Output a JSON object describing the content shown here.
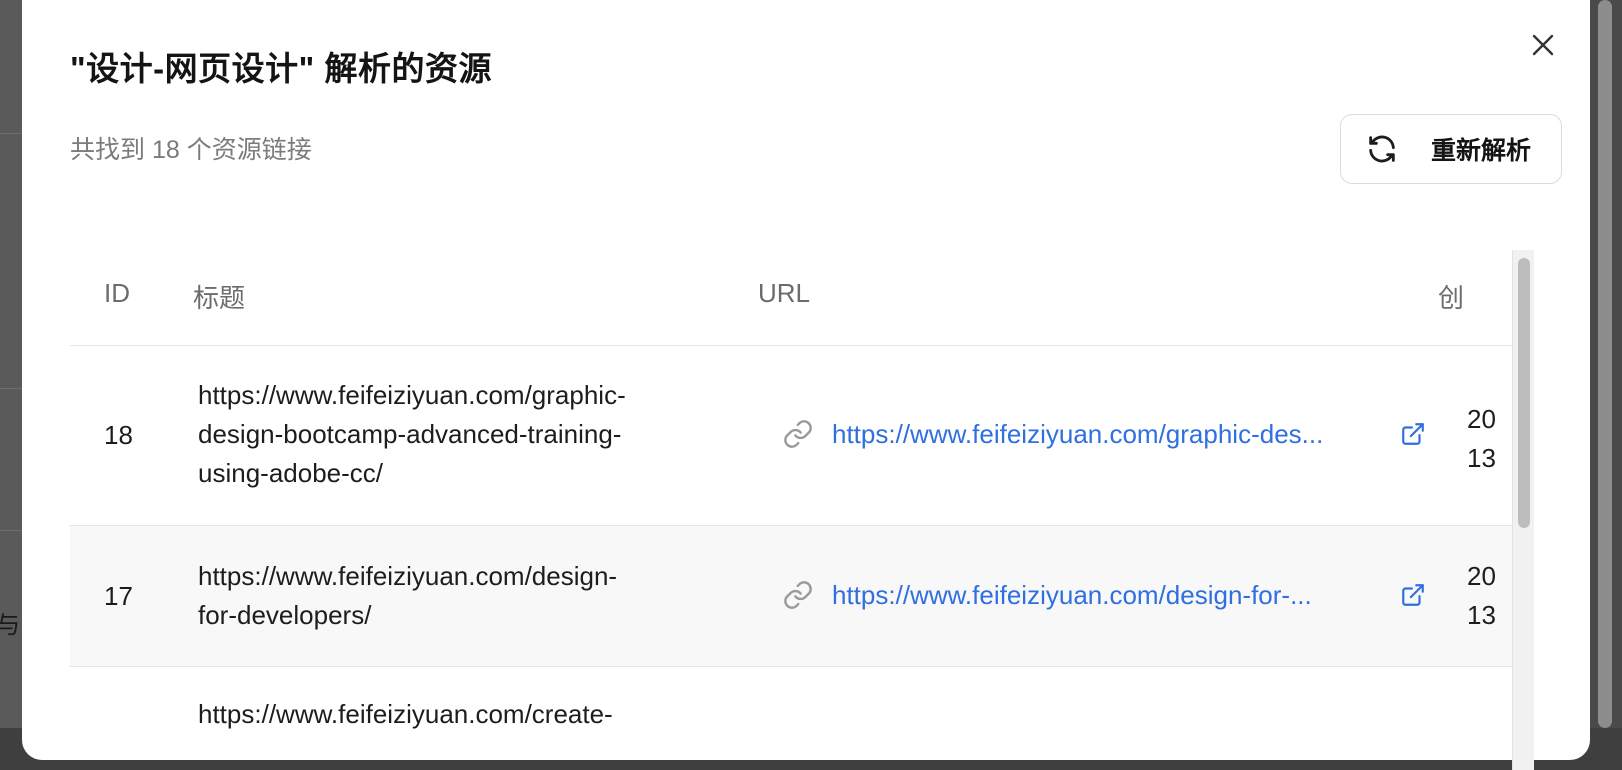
{
  "dialog": {
    "title": "\"设计-网页设计\" 解析的资源",
    "summary": "共找到 18 个资源链接",
    "reparse_label": "重新解析",
    "close_icon": "close-icon",
    "refresh_icon": "refresh-icon"
  },
  "backdrop": {
    "partial_char": "与"
  },
  "table": {
    "headers": {
      "id": "ID",
      "title": "标题",
      "url": "URL",
      "created": "创"
    },
    "rows": [
      {
        "id": "18",
        "title_lines": [
          "https://www.feifeiziyuan.com/graphic-",
          "design-bootcamp-advanced-training-",
          "using-adobe-cc/"
        ],
        "url_text": "https://www.feifeiziyuan.com/graphic-des...",
        "date_lines": [
          "20",
          "13"
        ]
      },
      {
        "id": "17",
        "title_lines": [
          "https://www.feifeiziyuan.com/design-",
          "for-developers/"
        ],
        "url_text": "https://www.feifeiziyuan.com/design-for-...",
        "date_lines": [
          "20",
          "13"
        ]
      },
      {
        "id": "",
        "title_lines": [
          "https://www.feifeiziyuan.com/create-"
        ],
        "url_text": "",
        "date_lines": []
      }
    ]
  },
  "colors": {
    "link": "#2f6fe0",
    "muted": "#7b7b7b"
  }
}
